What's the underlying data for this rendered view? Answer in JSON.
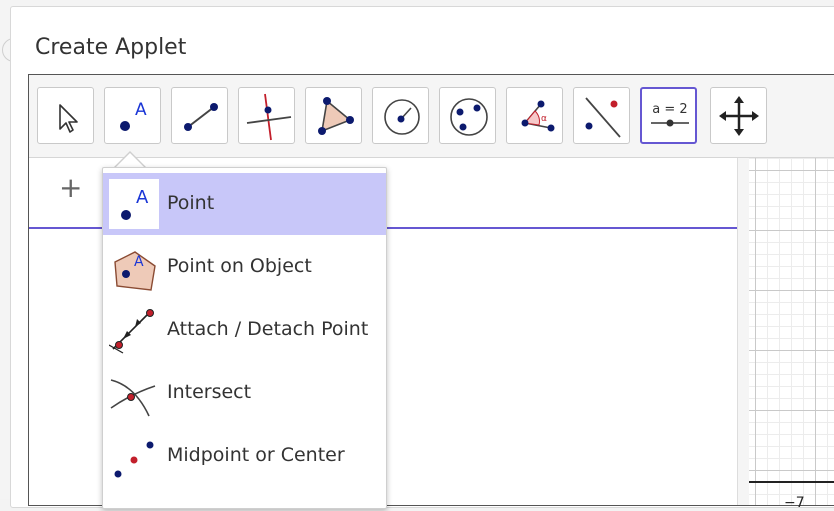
{
  "dialog": {
    "title": "Create Applet"
  },
  "toolbar": {
    "tools": [
      {
        "name": "Move",
        "icon": "arrow-cursor-icon"
      },
      {
        "name": "Point",
        "icon": "point-icon",
        "label": "A"
      },
      {
        "name": "Segment",
        "icon": "segment-icon"
      },
      {
        "name": "Perpendicular Line",
        "icon": "perpendicular-line-icon"
      },
      {
        "name": "Polygon",
        "icon": "polygon-icon"
      },
      {
        "name": "Circle with Center",
        "icon": "circle-center-icon"
      },
      {
        "name": "Circle through 3 Points",
        "icon": "circle-three-points-icon"
      },
      {
        "name": "Angle",
        "icon": "angle-icon",
        "label": "α"
      },
      {
        "name": "Reflect about Line",
        "icon": "reflect-icon"
      },
      {
        "name": "Slider",
        "icon": "slider-icon",
        "label": "a = 2",
        "selected": true
      },
      {
        "name": "Move Graphics View",
        "icon": "move-view-icon"
      }
    ]
  },
  "algebra": {
    "add_label": "+"
  },
  "graphics": {
    "axis_label": "−7"
  },
  "dropdown": {
    "items": [
      {
        "label": "Point",
        "icon": "point-icon",
        "icon_label": "A",
        "active": true
      },
      {
        "label": "Point on Object",
        "icon": "point-on-object-icon",
        "icon_label": "A"
      },
      {
        "label": "Attach / Detach Point",
        "icon": "attach-detach-point-icon"
      },
      {
        "label": "Intersect",
        "icon": "intersect-icon"
      },
      {
        "label": "Midpoint or Center",
        "icon": "midpoint-icon"
      }
    ]
  },
  "colors": {
    "accent": "#6557d2",
    "highlight": "#c8c7f9",
    "point": "#0c1a6e",
    "red": "#c21f2b"
  }
}
